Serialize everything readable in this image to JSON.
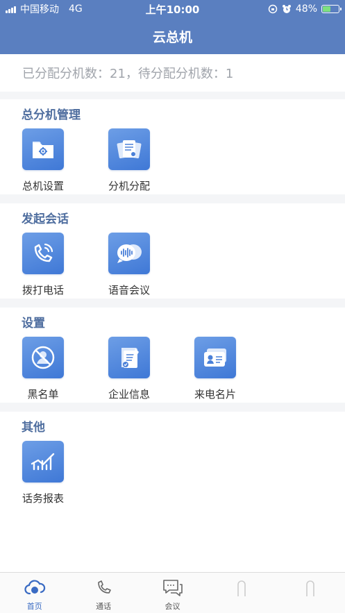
{
  "status_bar": {
    "carrier": "中国移动",
    "network": "4G",
    "time": "上午10:00",
    "battery": "48%",
    "battery_level": 0.48
  },
  "nav": {
    "title": "云总机"
  },
  "summary": {
    "text": "已分配分机数：21，待分配分机数：1"
  },
  "sections": [
    {
      "title": "总分机管理",
      "tiles": [
        {
          "label": "总机设置",
          "icon": "folder-gear-icon"
        },
        {
          "label": "分机分配",
          "icon": "documents-icon"
        }
      ]
    },
    {
      "title": "发起会话",
      "tiles": [
        {
          "label": "拨打电话",
          "icon": "phone-call-icon"
        },
        {
          "label": "语音会议",
          "icon": "voice-chat-icon"
        }
      ]
    },
    {
      "title": "设置",
      "tiles": [
        {
          "label": "黑名单",
          "icon": "blocked-user-icon"
        },
        {
          "label": "企业信息",
          "icon": "document-check-icon"
        },
        {
          "label": "来电名片",
          "icon": "contact-card-icon"
        }
      ]
    },
    {
      "title": "其他",
      "tiles": [
        {
          "label": "话务报表",
          "icon": "chart-icon"
        }
      ]
    }
  ],
  "tab_bar": {
    "tabs": [
      {
        "label": "首页",
        "icon": "home-cloud-icon",
        "active": true
      },
      {
        "label": "通话",
        "icon": "phone-icon",
        "active": false
      },
      {
        "label": "会议",
        "icon": "chat-bubbles-icon",
        "active": false
      },
      {
        "label": "",
        "icon": "loading-icon",
        "active": false
      },
      {
        "label": "",
        "icon": "loading-icon",
        "active": false
      }
    ]
  },
  "colors": {
    "brand": "#5a7fc0",
    "section_title": "#4f6e9f",
    "icon_gradient_top": "#6d9ee6",
    "icon_gradient_bottom": "#3f78d6",
    "active_tab": "#3a6bc3"
  }
}
